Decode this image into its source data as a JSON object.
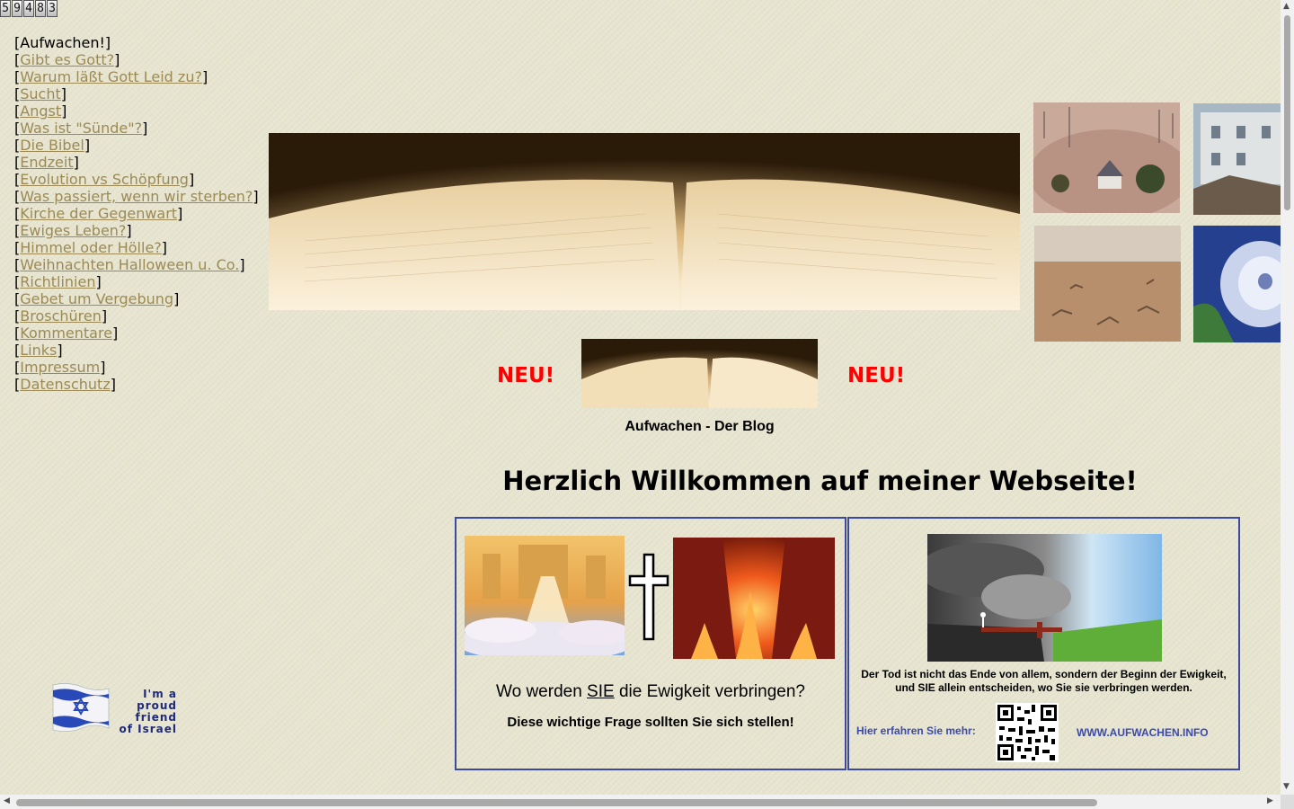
{
  "counter": {
    "digits": [
      "5",
      "9",
      "4",
      "8",
      "3"
    ]
  },
  "menu": {
    "current": "Aufwachen!",
    "links": [
      "Gibt es Gott?",
      "Warum läßt Gott Leid zu?",
      "Sucht",
      "Angst",
      "Was ist \"Sünde\"?",
      "Die Bibel",
      "Endzeit",
      "Evolution vs Schöpfung",
      "Was passiert, wenn wir sterben?",
      "Kirche der Gegenwart",
      "Ewiges Leben?",
      "Himmel oder Hölle?",
      "Weihnachten Halloween u. Co.",
      "Richtlinien",
      "Gebet um Vergebung",
      "Broschüren",
      "Kommentare",
      "Links",
      "Impressum",
      "Datenschutz"
    ]
  },
  "badge": {
    "line1": "I'm a proud",
    "line2": "friend",
    "line3": "of Israel"
  },
  "blog": {
    "neu_left": "NEU!",
    "neu_right": "NEU!",
    "caption": "Aufwachen - Der Blog"
  },
  "welcome": "Herzlich Willkommen auf meiner Webseite!",
  "box_left": {
    "title_pre": "Wo werden ",
    "title_emph": "SIE",
    "title_post": " die Ewigkeit verbringen?",
    "subtitle": "Diese wichtige Frage sollten Sie sich stellen!"
  },
  "box_right": {
    "text": "Der Tod ist nicht das Ende von allem, sondern der Beginn der Ewigkeit, und SIE allein entscheiden, wo Sie sie verbringen werden.",
    "more_label": "Hier erfahren Sie mehr:",
    "url_label": "WWW.AUFWACHEN.INFO"
  },
  "colors": {
    "link": "#9b8a55",
    "neu": "#ff0000",
    "box_border": "#3b4a9e",
    "info_blue": "#3b4aa8"
  }
}
